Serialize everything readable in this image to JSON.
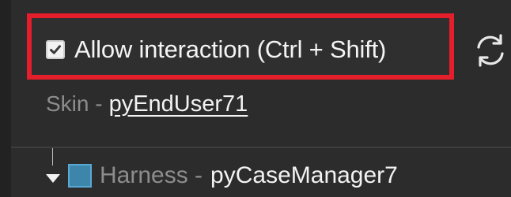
{
  "interaction": {
    "checkbox_checked": true,
    "label": "Allow interaction (Ctrl + Shift)",
    "highlight_color": "#e41e2b"
  },
  "refresh": {
    "icon": "refresh-icon"
  },
  "skin": {
    "label": "Skin -",
    "value": "pyEndUser71"
  },
  "tree": {
    "toggle_icon": "expand-triangle-icon",
    "node_icon": "harness-icon",
    "node_icon_color": "#5cb8e6",
    "label": "Harness -",
    "value": "pyCaseManager7"
  }
}
